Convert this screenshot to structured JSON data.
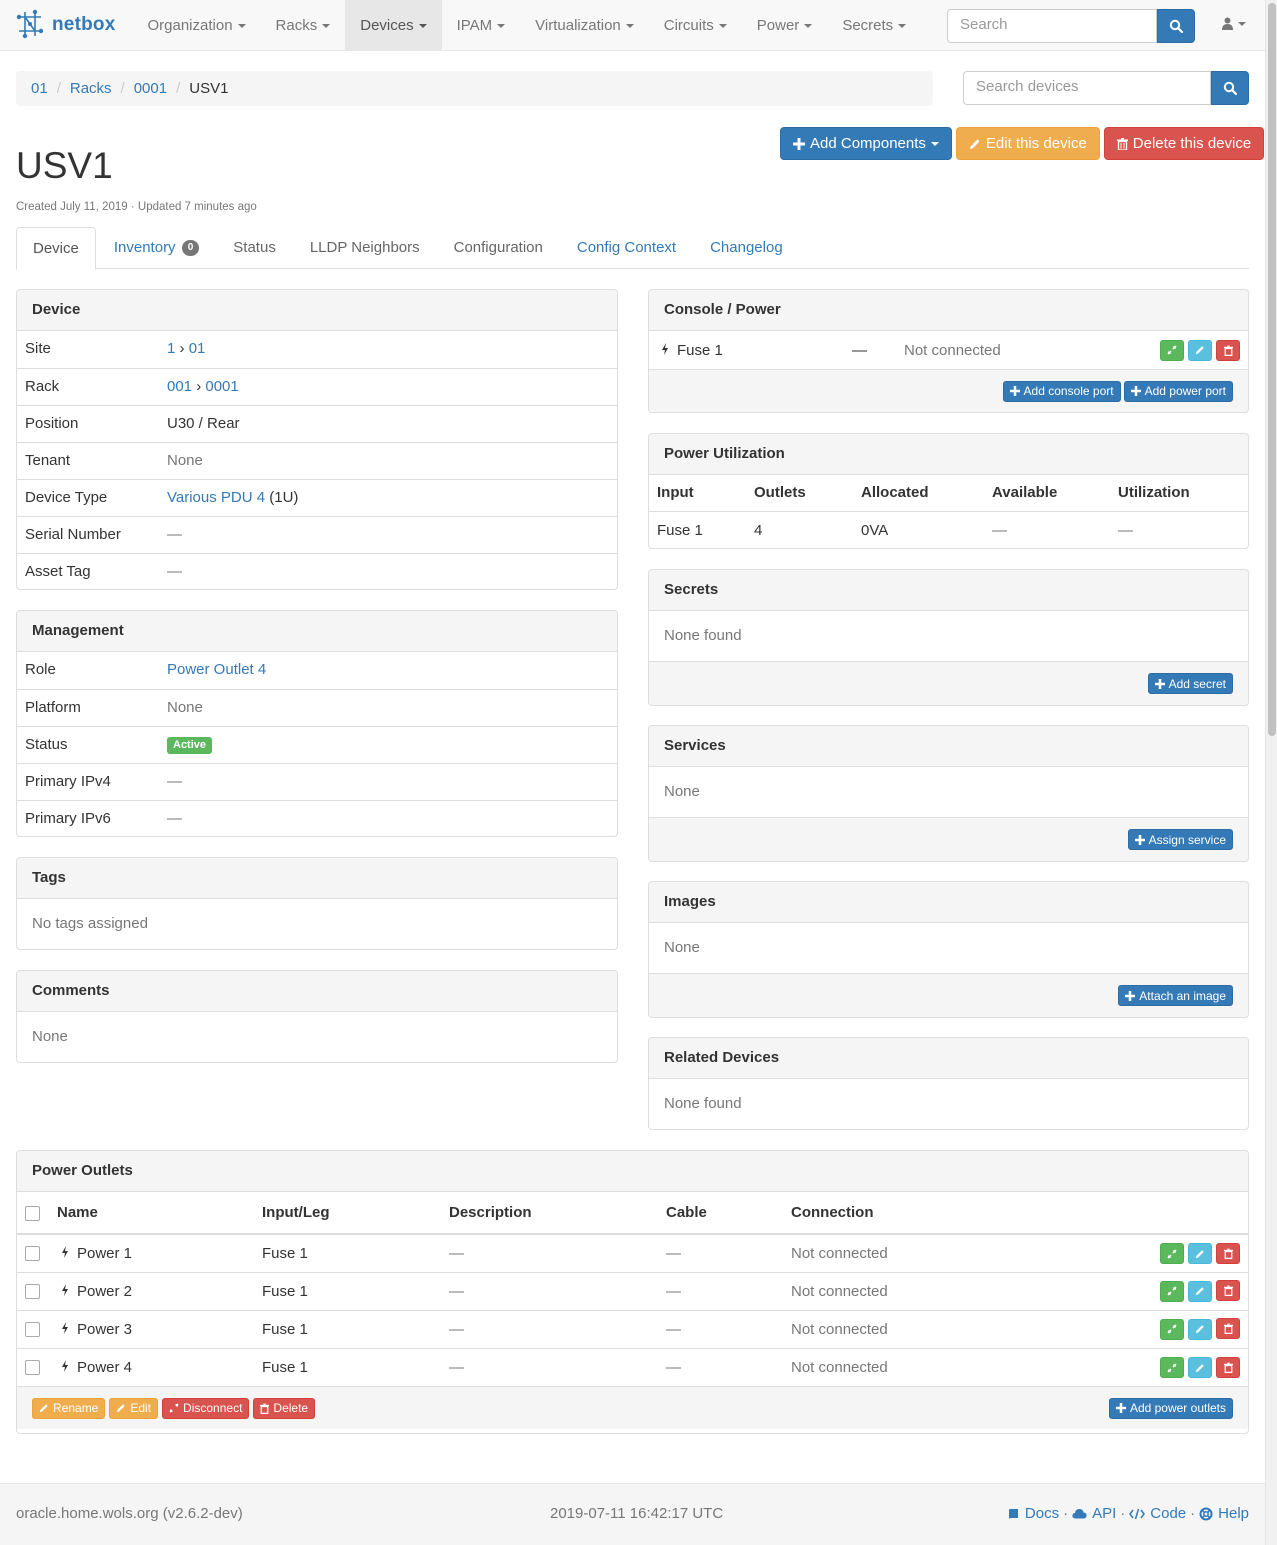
{
  "navbar": {
    "brand": "netbox",
    "items": [
      {
        "label": "Organization"
      },
      {
        "label": "Racks"
      },
      {
        "label": "Devices"
      },
      {
        "label": "IPAM"
      },
      {
        "label": "Virtualization"
      },
      {
        "label": "Circuits"
      },
      {
        "label": "Power"
      },
      {
        "label": "Secrets"
      }
    ],
    "search_placeholder": "Search"
  },
  "breadcrumb": [
    "01",
    "Racks",
    "0001",
    "USV1"
  ],
  "device_search_placeholder": "Search devices",
  "actions": {
    "add_components": "Add Components",
    "edit": "Edit this device",
    "delete": "Delete this device"
  },
  "device_name": "USV1",
  "meta": "Created July 11, 2019 · Updated 7 minutes ago",
  "tabs": {
    "device": "Device",
    "inventory": "Inventory",
    "inventory_count": "0",
    "status": "Status",
    "lldp": "LLDP Neighbors",
    "configuration": "Configuration",
    "config_context": "Config Context",
    "changelog": "Changelog"
  },
  "device_panel": {
    "title": "Device",
    "site_label": "Site",
    "site_a": "1",
    "site_b": "01",
    "rack_label": "Rack",
    "rack_a": "001",
    "rack_b": "0001",
    "position_label": "Position",
    "position": "U30 / Rear",
    "tenant_label": "Tenant",
    "tenant": "None",
    "type_label": "Device Type",
    "type": "Various PDU 4",
    "type_height": "(1U)",
    "serial_label": "Serial Number",
    "serial": "—",
    "asset_label": "Asset Tag",
    "asset": "—"
  },
  "management": {
    "title": "Management",
    "role_label": "Role",
    "role": "Power Outlet 4",
    "platform_label": "Platform",
    "platform": "None",
    "status_label": "Status",
    "status": "Active",
    "ipv4_label": "Primary IPv4",
    "ipv4": "—",
    "ipv6_label": "Primary IPv6",
    "ipv6": "—"
  },
  "tags": {
    "title": "Tags",
    "body": "No tags assigned"
  },
  "comments": {
    "title": "Comments",
    "body": "None"
  },
  "console_power": {
    "title": "Console / Power",
    "port_name": "Fuse 1",
    "port_dash": "—",
    "port_status": "Not connected",
    "add_console": "Add console port",
    "add_power": "Add power port"
  },
  "power_util": {
    "title": "Power Utilization",
    "headers": [
      "Input",
      "Outlets",
      "Allocated",
      "Available",
      "Utilization"
    ],
    "row": [
      "Fuse 1",
      "4",
      "0VA",
      "—",
      "—"
    ]
  },
  "secrets": {
    "title": "Secrets",
    "body": "None found",
    "add": "Add secret"
  },
  "services": {
    "title": "Services",
    "body": "None",
    "add": "Assign service"
  },
  "images": {
    "title": "Images",
    "body": "None",
    "add": "Attach an image"
  },
  "related": {
    "title": "Related Devices",
    "body": "None found"
  },
  "power_outlets": {
    "title": "Power Outlets",
    "headers": [
      "Name",
      "Input/Leg",
      "Description",
      "Cable",
      "Connection"
    ],
    "rows": [
      {
        "name": "Power 1",
        "leg": "Fuse 1",
        "desc": "—",
        "cable": "—",
        "conn": "Not connected"
      },
      {
        "name": "Power 2",
        "leg": "Fuse 1",
        "desc": "—",
        "cable": "—",
        "conn": "Not connected"
      },
      {
        "name": "Power 3",
        "leg": "Fuse 1",
        "desc": "—",
        "cable": "—",
        "conn": "Not connected"
      },
      {
        "name": "Power 4",
        "leg": "Fuse 1",
        "desc": "—",
        "cable": "—",
        "conn": "Not connected"
      }
    ],
    "rename": "Rename",
    "edit": "Edit",
    "disconnect": "Disconnect",
    "delete": "Delete",
    "add": "Add power outlets"
  },
  "footer": {
    "host": "oracle.home.wols.org (v2.6.2-dev)",
    "time": "2019-07-11 16:42:17 UTC",
    "docs": "Docs",
    "api": "API",
    "code": "Code",
    "help": "Help"
  }
}
